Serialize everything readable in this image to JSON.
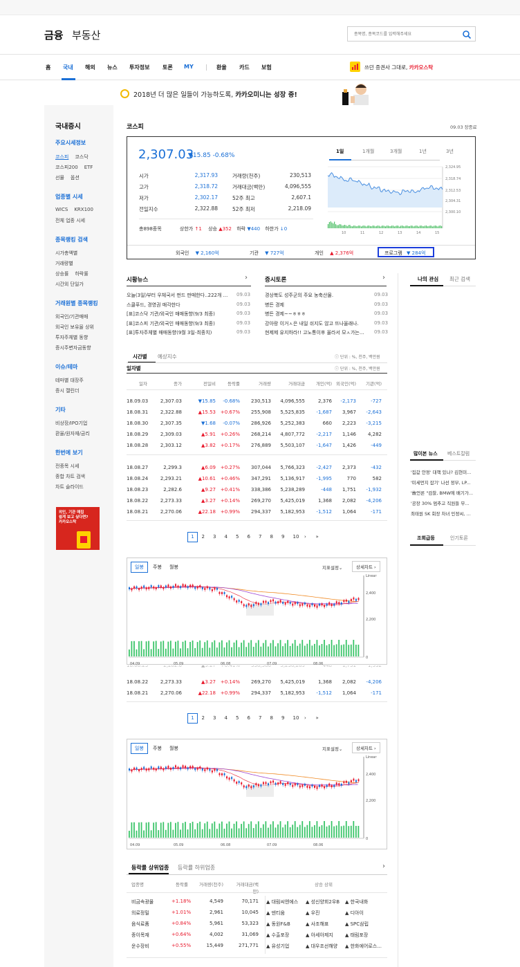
{
  "header": {
    "logo": "금융",
    "logo2": "부동산",
    "search_placeholder": "종목명, 종목코드를 입력해주세요"
  },
  "nav": {
    "items": [
      "홈",
      "국내",
      "해외",
      "뉴스",
      "투자정보",
      "토론",
      "MY",
      "환율",
      "카드",
      "보험"
    ],
    "active": 1,
    "promo_text": "쓰던 증권사 그대로,",
    "promo_link": "카카오스탁"
  },
  "banner": {
    "text": "2018년 더 많은 일들이 가능하도록,",
    "bold": "카카오미니는 성장 중!"
  },
  "left": {
    "title": "국내증시",
    "groups": [
      {
        "head": "주요시세정보",
        "rows": [
          [
            "코스피",
            "코스닥"
          ],
          [
            "코스피200",
            "ETF"
          ],
          [
            "선물",
            "옵션"
          ]
        ]
      },
      {
        "head": "업종별 시세",
        "rows": [
          [
            "WICS",
            "KRX100"
          ],
          [
            "전체 업종 시세"
          ]
        ]
      },
      {
        "head": "종목랭킹 검색",
        "rows": [
          [
            "시가총액별"
          ],
          [
            "거래량별"
          ],
          [
            "상승률",
            "하락률"
          ],
          [
            "시간외 단일가"
          ]
        ]
      },
      {
        "head": "거래원별 종목랭킹",
        "rows": [
          [
            "외국인/기관매매"
          ],
          [
            "외국인 보유율 상위"
          ],
          [
            "투자주체별 동향"
          ],
          [
            "증시주변자금동향"
          ]
        ]
      },
      {
        "head": "이슈/테마",
        "rows": [
          [
            "테마별 대장주"
          ],
          [
            "증시 캘린더"
          ]
        ]
      },
      {
        "head": "기타",
        "rows": [
          [
            "비상장/IPO기업"
          ],
          [
            "환율/원자재/금리"
          ]
        ]
      },
      {
        "head": "한번에 보기",
        "rows": [
          [
            "전종목 시세"
          ],
          [
            "종합 차트 검색"
          ],
          [
            "차트 슬라이드"
          ]
        ]
      }
    ],
    "ad": [
      "외인, 기관 매집",
      "쉽게 보고 싶다면?",
      "카카오스탁"
    ]
  },
  "kospi": {
    "title": "코스피",
    "status": "09.03 장종료",
    "value": "2,307.03",
    "change": "▼15.85",
    "rate": "-0.68%",
    "stats": [
      [
        "시가",
        "2,317.93",
        "거래량(천주)",
        "230,513"
      ],
      [
        "고가",
        "2,318.72",
        "거래대금(백만)",
        "4,096,555"
      ],
      [
        "저가",
        "2,302.17",
        "52주 최고",
        "2,607.1"
      ],
      [
        "전일지수",
        "2,322.88",
        "52주 최저",
        "2,218.09"
      ]
    ],
    "summary": {
      "total": "총898종목",
      "upper_l": "상한가",
      "upper": "1",
      "rise_l": "상승",
      "rise": "352",
      "fall_l": "하락",
      "fall": "440",
      "lower_l": "하한가",
      "lower": "0"
    },
    "tabs": [
      "1일",
      "1개월",
      "3개월",
      "1년",
      "3년"
    ],
    "mini_y": [
      "2,324.95",
      "2,318.74",
      "2,312.53",
      "2,304.31",
      "2,300.10"
    ],
    "mini_x": [
      "10",
      "11",
      "12",
      "13",
      "14",
      "15"
    ],
    "investors": [
      {
        "label": "외국인",
        "value": "2,160억",
        "dir": "down"
      },
      {
        "label": "기관",
        "value": "727억",
        "dir": "down"
      },
      {
        "label": "개인",
        "value": "2,376억",
        "dir": "up"
      },
      {
        "label": "프로그램",
        "value": "284억",
        "dir": "down"
      }
    ]
  },
  "news": {
    "head": "시황뉴스",
    "items": [
      [
        "오늘(3일)부터 우체국서 펀드 판매한다..222개 ...",
        "09.03"
      ],
      [
        "스쿨푸드, 경영권 매각한다",
        "09.03"
      ],
      [
        "[표]코스닥 기관/외국인 매매동향(9/3 최종)",
        "09.03"
      ],
      [
        "[표]코스피 기관/외국인 매매동향(9/3 최종)",
        "09.03"
      ],
      [
        "[표]투자주체별 매매동향(9월 3일-최종치)",
        "09.03"
      ]
    ]
  },
  "forum": {
    "head": "증시토론",
    "items": [
      [
        "경상북도 성주군의 주요 농축산물.",
        "09.03"
      ],
      [
        "병든 경제",
        "09.03"
      ],
      [
        "병든 경제~~ㅎㅎㅎ",
        "09.03"
      ],
      [
        "강아랑 이거ㅅ은 내일 쉬지도 않고 뜨나올래나.",
        "09.03"
      ],
      [
        "현제제 유지하라!! 고노통이후 올라서 모ㅅ가는...",
        "09.03"
      ]
    ]
  },
  "daily": {
    "tabs": [
      "시간별",
      "예상지수"
    ],
    "subtitle": "일자별",
    "unit": "단위 : %, 천주, 백만원",
    "cols": [
      "일자",
      "종가",
      "전일비",
      "등락률",
      "거래량",
      "거래대금",
      "개인(억)",
      "외국인(억)",
      "기관(억)"
    ],
    "rows": [
      [
        "18.09.03",
        "2,307.03",
        "▼15.85",
        "-0.68%",
        "230,513",
        "4,096,555",
        "2,376",
        "-2,173",
        "-727"
      ],
      [
        "18.08.31",
        "2,322.88",
        "▲15.53",
        "+0.67%",
        "255,908",
        "5,525,835",
        "-1,687",
        "3,967",
        "-2,643"
      ],
      [
        "18.08.30",
        "2,307.35",
        "▼1.68",
        "-0.07%",
        "286,926",
        "5,252,383",
        "660",
        "2,223",
        "-3,215"
      ],
      [
        "18.08.29",
        "2,309.03",
        "▲5.91",
        "+0.26%",
        "268,214",
        "4,807,772",
        "-2,217",
        "1,146",
        "4,282"
      ],
      [
        "18.08.28",
        "2,303.12",
        "▲3.82",
        "+0.17%",
        "276,889",
        "5,503,107",
        "-1,647",
        "1,426",
        "-449"
      ],
      [
        "18.08.27",
        "2,299.3",
        "▲6.09",
        "+0.27%",
        "307,044",
        "5,766,323",
        "-2,427",
        "2,373",
        "-432"
      ],
      [
        "18.08.24",
        "2,293.21",
        "▲10.61",
        "+0.46%",
        "347,291",
        "5,136,917",
        "-1,995",
        "770",
        "582"
      ],
      [
        "18.08.23",
        "2,282.6",
        "▲9.27",
        "+0.41%",
        "338,386",
        "5,238,289",
        "-448",
        "1,751",
        "-1,932"
      ],
      [
        "18.08.22",
        "2,273.33",
        "▲3.27",
        "+0.14%",
        "269,270",
        "5,425,019",
        "1,368",
        "2,082",
        "-4,206"
      ],
      [
        "18.08.21",
        "2,270.06",
        "▲22.18",
        "+0.99%",
        "294,337",
        "5,182,953",
        "-1,512",
        "1,064",
        "-171"
      ]
    ],
    "pages": [
      "1",
      "2",
      "3",
      "4",
      "5",
      "6",
      "7",
      "8",
      "9",
      "10",
      "›",
      "»"
    ]
  },
  "chart": {
    "tabs": [
      "일봉",
      "주봉",
      "월봉"
    ],
    "setting": "지표설정",
    "detail": "상세차트",
    "y_labels": [
      "Linear",
      "2,400",
      "2,200",
      "0"
    ],
    "x_labels": [
      "04.09",
      "05.09",
      "06.08",
      "07.09",
      "08.06"
    ]
  },
  "ranking": {
    "tabs": [
      "등락률 상위업종",
      "등락률 하위업종"
    ],
    "cols": [
      "업종명",
      "등락률",
      "거래량(천주)",
      "거래대금(백만)",
      "상승 상위"
    ],
    "rows": [
      [
        "비금속광물",
        "+1.18%",
        "4,549",
        "70,171",
        "대림씨엔에스",
        "성신양회2우B",
        "한국내화"
      ],
      [
        "의료정밀",
        "+1.01%",
        "2,961",
        "10,045",
        "덴티움",
        "우진",
        "디아이"
      ],
      [
        "음식료품",
        "+0.84%",
        "5,961",
        "53,323",
        "동원F&B",
        "사조해표",
        "SPC삼립"
      ],
      [
        "종이목재",
        "+0.64%",
        "4,002",
        "31,069",
        "수출포장",
        "아세아제지",
        "태림포장"
      ],
      [
        "운수장비",
        "+0.55%",
        "15,449",
        "271,771",
        "유성기업",
        "대우조선해양",
        "한화에어로스..."
      ]
    ]
  },
  "right": {
    "tabs1": [
      "나의 관심",
      "최근 검색"
    ],
    "tabs2": [
      "많이본 뉴스",
      "베스트칼럼"
    ],
    "news": [
      "'집값 안정' 대책 있나? 김현미...",
      "'미세먼지 잡기' 나선 정부, LP...",
      "'故언론 \"검찰, BMW에 배기가...",
      "'공장 30% 멈추고 직원들 무...",
      "최태원 SK 회장 차녀 민정씨, ..."
    ],
    "tabs3": [
      "조회급등",
      "인기토론"
    ]
  },
  "colors": {
    "accent": "#1a6fd6",
    "up": "#e8192c",
    "down": "#1a6fd6"
  }
}
